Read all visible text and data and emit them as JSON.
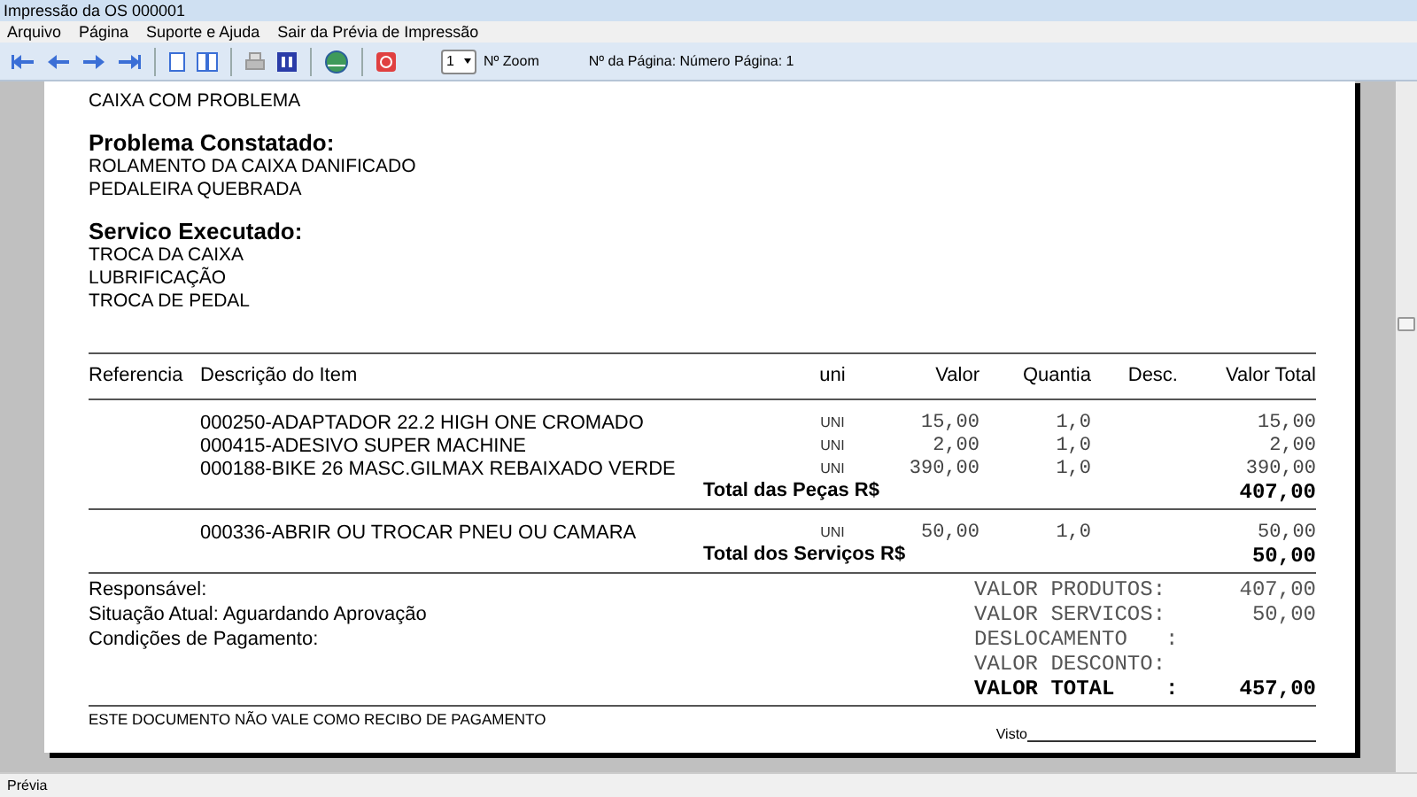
{
  "window": {
    "title": "Impressão da OS 000001"
  },
  "menu": [
    {
      "label": "Arquivo"
    },
    {
      "label": "Página"
    },
    {
      "label": "Suporte e Ajuda"
    },
    {
      "label": "Sair da Prévia de Impressão"
    }
  ],
  "toolbar": {
    "zoom_value": "1",
    "zoom_label": "Nº Zoom",
    "page_info": "Nº da Página: Número Página: 1"
  },
  "report": {
    "sections": [
      {
        "lines": [
          "CAIXA COM PROBLEMA"
        ]
      },
      {
        "heading": "Problema Constatado:",
        "lines": [
          "ROLAMENTO DA CAIXA DANIFICADO",
          "PEDALEIRA QUEBRADA"
        ]
      },
      {
        "heading": "Servico Executado:",
        "lines": [
          "TROCA DA CAIXA",
          "LUBRIFICAÇÃO",
          "TROCA DE PEDAL"
        ]
      }
    ],
    "columns": [
      "Referencia",
      "Descrição do Item",
      "uni",
      "Valor",
      "Quantia",
      "Desc.",
      "Valor Total"
    ],
    "groups": [
      {
        "rows": [
          {
            "description": "000250-ADAPTADOR 22.2 HIGH ONE CROMADO",
            "unit": "UNI",
            "value": "15,00",
            "quantity": "1,0",
            "total": "15,00"
          },
          {
            "description": "000415-ADESIVO SUPER MACHINE",
            "unit": "UNI",
            "value": "2,00",
            "quantity": "1,0",
            "total": "2,00"
          },
          {
            "description": "000188-BIKE 26 MASC.GILMAX REBAIXADO VERDE",
            "unit": "UNI",
            "value": "390,00",
            "quantity": "1,0",
            "total": "390,00"
          }
        ],
        "total_label": "Total das Peças R$",
        "total_value": "407,00"
      },
      {
        "rows": [
          {
            "description": "000336-ABRIR OU TROCAR PNEU OU CAMARA",
            "unit": "UNI",
            "value": "50,00",
            "quantity": "1,0",
            "total": "50,00"
          }
        ],
        "total_label": "Total dos Serviços R$",
        "total_value": "50,00"
      }
    ],
    "info": [
      "Responsável:",
      "Situação Atual: Aguardando Aprovação",
      "Condições de Pagamento:"
    ],
    "summary": [
      {
        "label": "VALOR PRODUTOS:",
        "value": "407,00",
        "bold": false
      },
      {
        "label": "VALOR SERVICOS:",
        "value": "50,00",
        "bold": false
      },
      {
        "label": "DESLOCAMENTO   :",
        "bold": false
      },
      {
        "label": "VALOR DESCONTO:",
        "bold": false
      },
      {
        "label": "VALOR TOTAL    :",
        "value": "457,00",
        "bold": true
      }
    ],
    "footer_note": "ESTE DOCUMENTO NÃO VALE COMO RECIBO DE PAGAMENTO",
    "signature_label": "Visto"
  },
  "status_bar": "Prévia"
}
